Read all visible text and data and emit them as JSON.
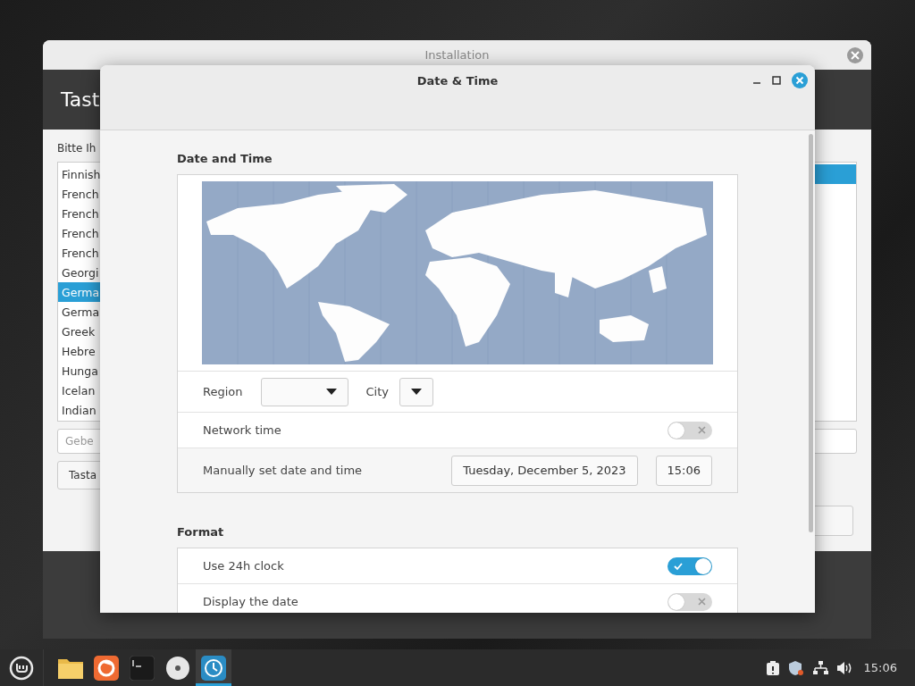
{
  "background_window": {
    "title": "Installation",
    "heading": "Tast",
    "prompt": "Bitte Ih",
    "layouts": [
      {
        "label": "Finnish",
        "selected": false
      },
      {
        "label": "French",
        "selected": false
      },
      {
        "label": "French",
        "selected": false
      },
      {
        "label": "French",
        "selected": false
      },
      {
        "label": "French",
        "selected": false
      },
      {
        "label": "Georgi",
        "selected": false
      },
      {
        "label": "Germa",
        "selected": true
      },
      {
        "label": "Germa",
        "selected": false
      },
      {
        "label": "Greek",
        "selected": false
      },
      {
        "label": "Hebre",
        "selected": false
      },
      {
        "label": "Hunga",
        "selected": false
      },
      {
        "label": "Icelan",
        "selected": false
      },
      {
        "label": "Indian",
        "selected": false
      }
    ],
    "variants": [
      {
        "selected": true
      }
    ],
    "search": {
      "placeholder": "Gebe"
    },
    "button": "Tasta"
  },
  "dialog": {
    "title": "Date & Time",
    "sections": [
      {
        "heading": "Date and Time",
        "rows": [
          {
            "kind": "map"
          },
          {
            "kind": "location",
            "region_label": "Region",
            "city_label": "City"
          },
          {
            "kind": "switch",
            "label": "Network time",
            "on": false
          },
          {
            "kind": "datetime",
            "label": "Manually set date and time",
            "date": "Tuesday, December 5, 2023",
            "time": "15:06"
          }
        ]
      },
      {
        "heading": "Format",
        "rows": [
          {
            "kind": "switch",
            "label": "Use 24h clock",
            "on": true
          },
          {
            "kind": "switch",
            "label": "Display the date",
            "on": false
          }
        ]
      }
    ]
  },
  "taskbar": {
    "apps": [
      {
        "kind": "folder",
        "active": false
      },
      {
        "kind": "browser",
        "active": false
      },
      {
        "kind": "terminal",
        "active": false
      },
      {
        "kind": "disc",
        "active": false
      },
      {
        "kind": "clock",
        "active": true
      }
    ],
    "clock": "15:06"
  }
}
